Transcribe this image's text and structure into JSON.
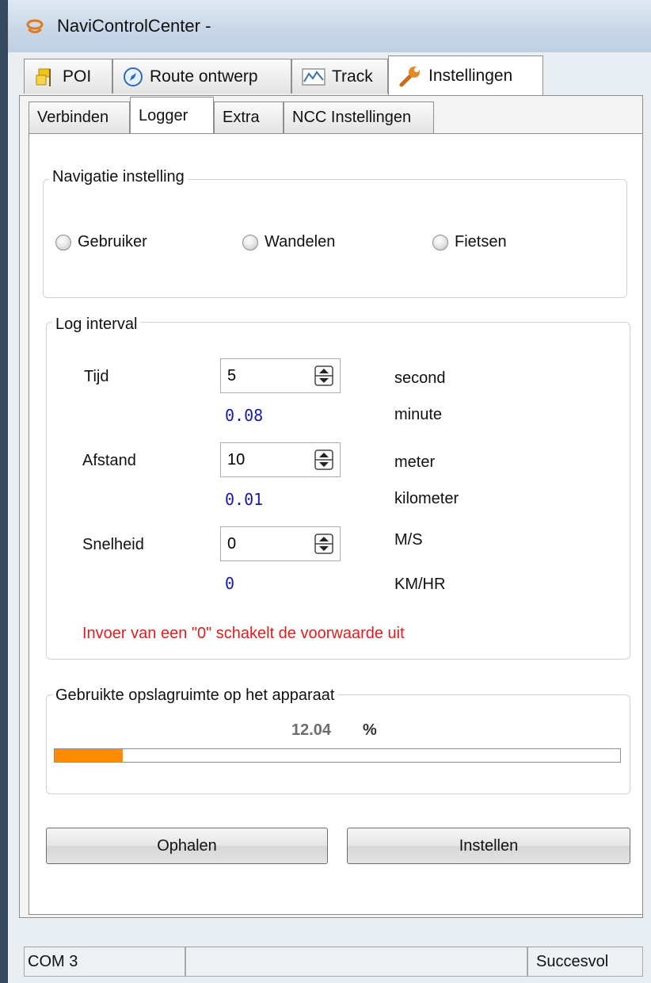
{
  "window": {
    "title": "NaviControlCenter -"
  },
  "tabs": [
    {
      "label": "POI",
      "icon": "poi-icon"
    },
    {
      "label": "Route ontwerp",
      "icon": "compass-icon"
    },
    {
      "label": "Track",
      "icon": "track-icon"
    },
    {
      "label": "Instellingen",
      "icon": "wrench-icon",
      "active": true
    }
  ],
  "subtabs": [
    {
      "label": "Verbinden"
    },
    {
      "label": "Logger",
      "active": true
    },
    {
      "label": "Extra"
    },
    {
      "label": "NCC Instellingen"
    }
  ],
  "navigation": {
    "title": "Navigatie instelling",
    "options": [
      "Gebruiker",
      "Wandelen",
      "Fietsen"
    ]
  },
  "log_interval": {
    "title": "Log interval",
    "time": {
      "label": "Tijd",
      "value": "5",
      "unit": "second",
      "converted": "0.08",
      "converted_unit": "minute"
    },
    "distance": {
      "label": "Afstand",
      "value": "10",
      "unit": "meter",
      "converted": "0.01",
      "converted_unit": "kilometer"
    },
    "speed": {
      "label": "Snelheid",
      "value": "0",
      "unit": "M/S",
      "converted": "0",
      "converted_unit": "KM/HR"
    },
    "warning": "Invoer van een \"0\" schakelt de voorwaarde uit"
  },
  "storage": {
    "title": "Gebruikte opslagruimte op het apparaat",
    "percent": "12.04",
    "percent_sign": "%",
    "fill_fraction": 0.1204
  },
  "buttons": {
    "fetch": "Ophalen",
    "set": "Instellen"
  },
  "status": {
    "port": "COM 3",
    "message": "Succesvol"
  },
  "colors": {
    "progress_fill": "#ff8c00",
    "warning": "#e11d1d",
    "converted_value": "#1a1aaa"
  }
}
